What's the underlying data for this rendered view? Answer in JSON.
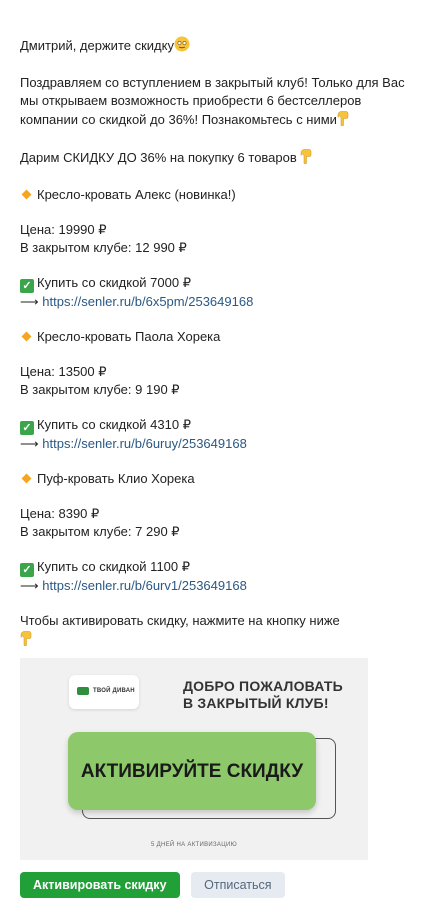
{
  "message": {
    "greeting": "Дмитрий, держите скидку",
    "intro": "Поздравляем со вступлением в закрытый клуб! Только для Вас мы открываем возможность приобрести 6 бестселлеров компании со скидкой до 36%! Познакомьтесь с ними",
    "offer": "Дарим СКИДКУ ДО 36% на покупку 6 товаров",
    "products": [
      {
        "name": "Кресло-кровать Алекс (новинка!)",
        "price": "Цена: 19990 ₽",
        "club_price": "В закрытом клубе: 12 990 ₽",
        "buy": "Купить со скидкой 7000 ₽",
        "arrow": "⟶",
        "link": "https://senler.ru/b/6x5pm/253649168"
      },
      {
        "name": "Кресло-кровать Паола Хорека",
        "price": "Цена: 13500 ₽",
        "club_price": "В закрытом клубе: 9 190 ₽",
        "buy": "Купить со скидкой 4310 ₽",
        "arrow": "⟶",
        "link": "https://senler.ru/b/6uruy/253649168"
      },
      {
        "name": "Пуф-кровать Клио Хорека",
        "price": "Цена: 8390 ₽",
        "club_price": "В закрытом клубе: 7 290 ₽",
        "buy": "Купить со скидкой 1100 ₽",
        "arrow": "⟶",
        "link": "https://senler.ru/b/6urv1/253649168"
      }
    ],
    "cta_text": "Чтобы активировать скидку, нажмите на кнопку ниже"
  },
  "banner": {
    "logo_text": "ТВОЙ ДИВАН",
    "title_line1": "ДОБРО ПОЖАЛОВАТЬ",
    "title_line2": "В ЗАКРЫТЫЙ КЛУБ!",
    "button_text": "АКТИВИРУЙТЕ СКИДКУ",
    "note": "5 ДНЕЙ НА АКТИВИЗАЦИЮ"
  },
  "actions": {
    "primary": "Активировать скидку",
    "secondary": "Отписаться"
  },
  "icons": {
    "emoji_face": "smiling-face-icon",
    "pointing": "backhand-index-pointing-down-icon",
    "bullet": "orange-diamond-icon",
    "check": "check-mark-button-icon"
  },
  "colors": {
    "link": "#2a5885",
    "primary_button": "#21a038",
    "secondary_button": "#e5ebf1",
    "banner_button": "#8dc96a"
  }
}
